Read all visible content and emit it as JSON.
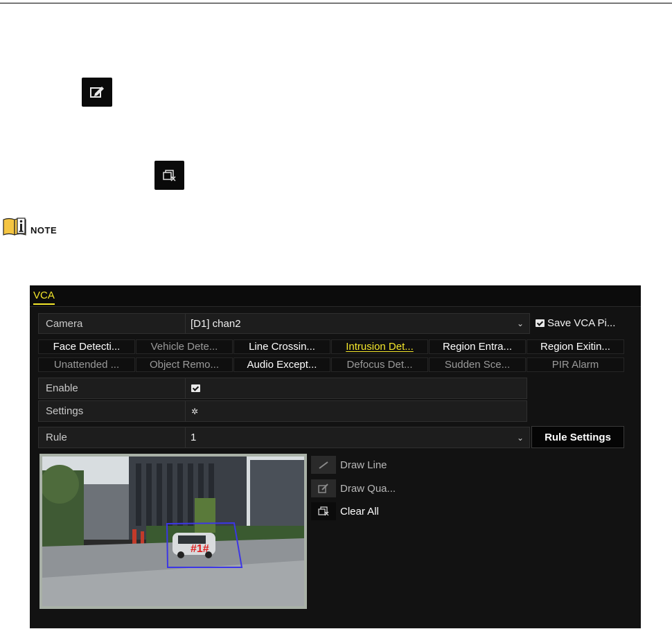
{
  "document": {
    "note_label": "NOTE"
  },
  "icons": {
    "edit_icon": "edit-icon",
    "clear_icon": "clear-all-icon",
    "note_icon": "info-note-icon"
  },
  "panel": {
    "tab": "VCA",
    "camera": {
      "label": "Camera",
      "value": "[D1] chan2"
    },
    "save_vca_label": "Save VCA Pi...",
    "save_vca_checked": true,
    "detection_tabs_row1": [
      {
        "label": "Face Detecti...",
        "state": "bright"
      },
      {
        "label": "Vehicle Dete...",
        "state": "dim"
      },
      {
        "label": "Line Crossin...",
        "state": "bright"
      },
      {
        "label": "Intrusion Det...",
        "state": "selected"
      },
      {
        "label": "Region Entra...",
        "state": "bright"
      },
      {
        "label": "Region Exitin...",
        "state": "bright"
      }
    ],
    "detection_tabs_row2": [
      {
        "label": "Unattended ...",
        "state": "dim"
      },
      {
        "label": "Object Remo...",
        "state": "dim"
      },
      {
        "label": "Audio Except...",
        "state": "bright"
      },
      {
        "label": "Defocus Det...",
        "state": "dim"
      },
      {
        "label": "Sudden Sce...",
        "state": "dim"
      },
      {
        "label": "PIR Alarm",
        "state": "dim"
      }
    ],
    "enable": {
      "label": "Enable",
      "checked": true
    },
    "settings": {
      "label": "Settings"
    },
    "rule": {
      "label": "Rule",
      "value": "1"
    },
    "rule_settings_button": "Rule Settings",
    "tools": {
      "draw_line": "Draw Line",
      "draw_quad": "Draw Qua...",
      "clear_all": "Clear All"
    },
    "preview": {
      "region_label": "#1#",
      "region_color": "#3c36e6"
    }
  },
  "colors": {
    "accent_yellow": "#f3e62b",
    "panel_bg": "#121212"
  }
}
